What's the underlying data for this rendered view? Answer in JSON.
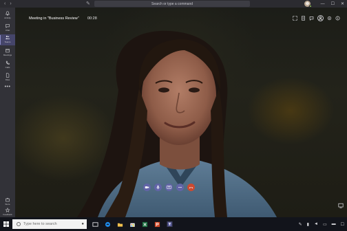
{
  "titlebar": {
    "search_placeholder": "Search or type a command",
    "nav_back": "‹",
    "nav_forward": "›",
    "edit_glyph": "✎",
    "minimize": "—",
    "maximize": "☐",
    "close": "✕",
    "presence_color": "#92c353"
  },
  "rail": {
    "items": [
      {
        "label": "Activity",
        "icon": "bell-icon"
      },
      {
        "label": "Chat",
        "icon": "chat-icon"
      },
      {
        "label": "Teams",
        "icon": "teams-icon",
        "active": true
      },
      {
        "label": "Meetings",
        "icon": "calendar-icon"
      },
      {
        "label": "Calls",
        "icon": "phone-icon"
      },
      {
        "label": "Files",
        "icon": "file-icon"
      },
      {
        "label": "Store",
        "icon": "store-icon"
      },
      {
        "label": "Feedback",
        "icon": "feedback-icon"
      }
    ],
    "more": "•••",
    "accent": "#6264a7"
  },
  "meeting": {
    "title": "Meeting in \"Business Review\"",
    "elapsed": "00:28"
  },
  "top_actions": [
    "expand-icon",
    "notes-icon",
    "chat-icon",
    "participants-icon",
    "settings-icon",
    "info-icon"
  ],
  "controls": {
    "items": [
      "video-camera-icon",
      "microphone-icon",
      "share-screen-icon",
      "more-options-icon",
      "hang-up-icon"
    ],
    "primary_color": "#6264a7",
    "hangup_color": "#cc4a31"
  },
  "taskbar": {
    "search_placeholder": "Type here to search",
    "apps": [
      "task-view-icon",
      "edge-icon",
      "file-explorer-icon",
      "store-icon",
      "excel-icon",
      "powerpoint-icon",
      "teams-icon"
    ]
  }
}
